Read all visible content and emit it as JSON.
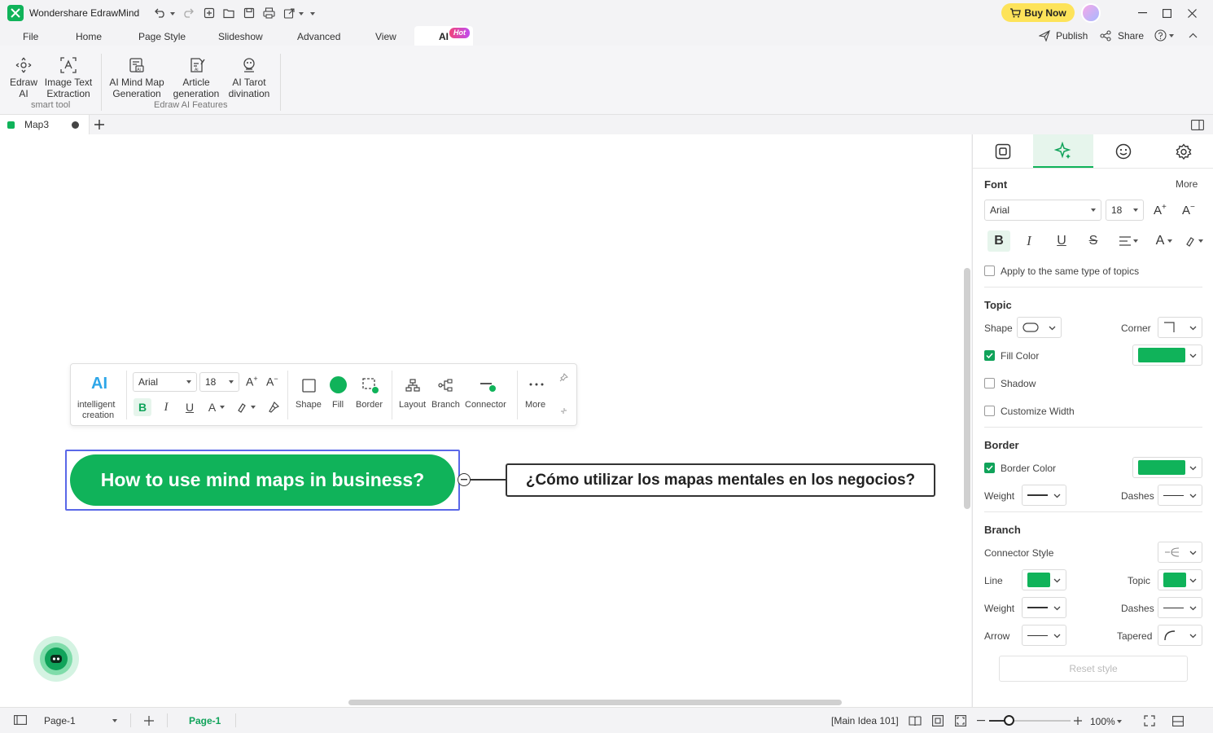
{
  "app": {
    "title": "Wondershare EdrawMind",
    "buy_now": "Buy Now"
  },
  "menu": {
    "file": "File",
    "home": "Home",
    "page_style": "Page Style",
    "slideshow": "Slideshow",
    "advanced": "Advanced",
    "view": "View",
    "ai": "AI",
    "ai_badge": "Hot",
    "publish": "Publish",
    "share": "Share"
  },
  "ribbon": {
    "edraw_ai": [
      "Edraw",
      "AI"
    ],
    "image_text": [
      "Image Text",
      "Extraction"
    ],
    "smart_tool": "smart tool",
    "ai_mind_map": [
      "AI Mind Map",
      "Generation"
    ],
    "article": [
      "Article",
      "generation"
    ],
    "tarot": [
      "AI Tarot",
      "divination"
    ],
    "ai_features": "Edraw AI Features"
  },
  "tabs": {
    "doc": "Map3"
  },
  "floating_toolbar": {
    "ai_label": [
      "intelligent",
      "creation"
    ],
    "ai_icon_text": "AI",
    "font": "Arial",
    "size": "18",
    "shape": "Shape",
    "fill": "Fill",
    "border": "Border",
    "layout": "Layout",
    "branch": "Branch",
    "connector": "Connector",
    "more": "More"
  },
  "mindmap": {
    "main_topic": "How to use mind maps in business?",
    "sub_topic": "¿Cómo utilizar los mapas mentales en los negocios?"
  },
  "panel": {
    "font_title": "Font",
    "more": "More",
    "font": "Arial",
    "size": "18",
    "apply_same": "Apply to the same type of topics",
    "topic_title": "Topic",
    "shape": "Shape",
    "corner": "Corner",
    "fill_color": "Fill Color",
    "shadow": "Shadow",
    "customize_width": "Customize Width",
    "border_title": "Border",
    "border_color": "Border Color",
    "weight": "Weight",
    "dashes": "Dashes",
    "branch_title": "Branch",
    "connector_style": "Connector Style",
    "line": "Line",
    "topic": "Topic",
    "weight2": "Weight",
    "dashes2": "Dashes",
    "arrow": "Arrow",
    "tapered": "Tapered",
    "reset": "Reset style"
  },
  "status": {
    "page_select": "Page-1",
    "page_tab": "Page-1",
    "selection": "[Main Idea 101]",
    "zoom": "100%"
  },
  "colors": {
    "accent": "#10b35a",
    "selection": "#5a68e8"
  }
}
